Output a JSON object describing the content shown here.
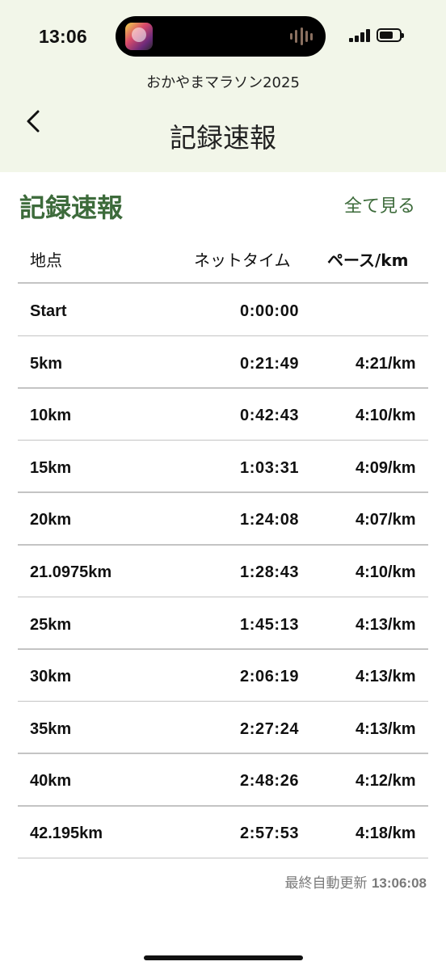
{
  "status_bar": {
    "time": "13:06"
  },
  "header": {
    "app_name": "おかやまマラソン2025",
    "title": "記録速報"
  },
  "section": {
    "title": "記録速報",
    "see_all": "全て見る"
  },
  "table": {
    "columns": [
      "地点",
      "ネットタイム",
      "ペース/km"
    ],
    "rows": [
      {
        "point": "Start",
        "net_time": "0:00:00",
        "pace": ""
      },
      {
        "point": "5km",
        "net_time": "0:21:49",
        "pace": "4:21/km"
      },
      {
        "point": "10km",
        "net_time": "0:42:43",
        "pace": "4:10/km"
      },
      {
        "point": "15km",
        "net_time": "1:03:31",
        "pace": "4:09/km"
      },
      {
        "point": "20km",
        "net_time": "1:24:08",
        "pace": "4:07/km"
      },
      {
        "point": "21.0975km",
        "net_time": "1:28:43",
        "pace": "4:10/km"
      },
      {
        "point": "25km",
        "net_time": "1:45:13",
        "pace": "4:13/km"
      },
      {
        "point": "30km",
        "net_time": "2:06:19",
        "pace": "4:13/km"
      },
      {
        "point": "35km",
        "net_time": "2:27:24",
        "pace": "4:13/km"
      },
      {
        "point": "40km",
        "net_time": "2:48:26",
        "pace": "4:12/km"
      },
      {
        "point": "42.195km",
        "net_time": "2:57:53",
        "pace": "4:18/km"
      }
    ]
  },
  "footer": {
    "updated_label": "最終自動更新",
    "updated_time": "13:06:08"
  },
  "icons": {
    "back": "chevron-left-icon",
    "signal": "cellular-signal-icon",
    "battery": "battery-icon",
    "waveform": "audio-waveform-icon"
  },
  "colors": {
    "accent_green": "#3d6b3b",
    "header_bg": "#f2f6e9"
  }
}
